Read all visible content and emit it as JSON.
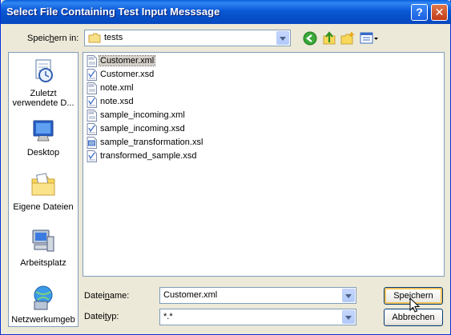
{
  "window": {
    "title": "Select File Containing Test Input Messsage",
    "help_symbol": "?",
    "close_symbol": "✕"
  },
  "toolbar": {
    "save_in_label": "Speichern in:",
    "current_folder": "tests",
    "icons": [
      "back-icon",
      "up-folder-icon",
      "new-folder-icon",
      "view-menu-icon"
    ]
  },
  "places": [
    {
      "label": "Zuletzt verwendete D...",
      "icon": "recent-documents-icon"
    },
    {
      "label": "Desktop",
      "icon": "desktop-icon"
    },
    {
      "label": "Eigene Dateien",
      "icon": "my-documents-icon"
    },
    {
      "label": "Arbeitsplatz",
      "icon": "my-computer-icon"
    },
    {
      "label": "Netzwerkumgeb",
      "icon": "network-icon"
    }
  ],
  "files": [
    {
      "name": "Customer.xml",
      "type": "xml",
      "selected": true
    },
    {
      "name": "Customer.xsd",
      "type": "xsd",
      "selected": false
    },
    {
      "name": "note.xml",
      "type": "xml",
      "selected": false
    },
    {
      "name": "note.xsd",
      "type": "xsd",
      "selected": false
    },
    {
      "name": "sample_incoming.xml",
      "type": "xml",
      "selected": false
    },
    {
      "name": "sample_incoming.xsd",
      "type": "xsd",
      "selected": false
    },
    {
      "name": "sample_transformation.xsl",
      "type": "xsl",
      "selected": false
    },
    {
      "name": "transformed_sample.xsd",
      "type": "xsd",
      "selected": false
    }
  ],
  "form": {
    "filename_label": "Dateiname:",
    "filename_value": "Customer.xml",
    "filetype_label": "Dateityp:",
    "filetype_value": "*.*"
  },
  "buttons": {
    "save": "Speichern",
    "cancel": "Abbrechen"
  }
}
